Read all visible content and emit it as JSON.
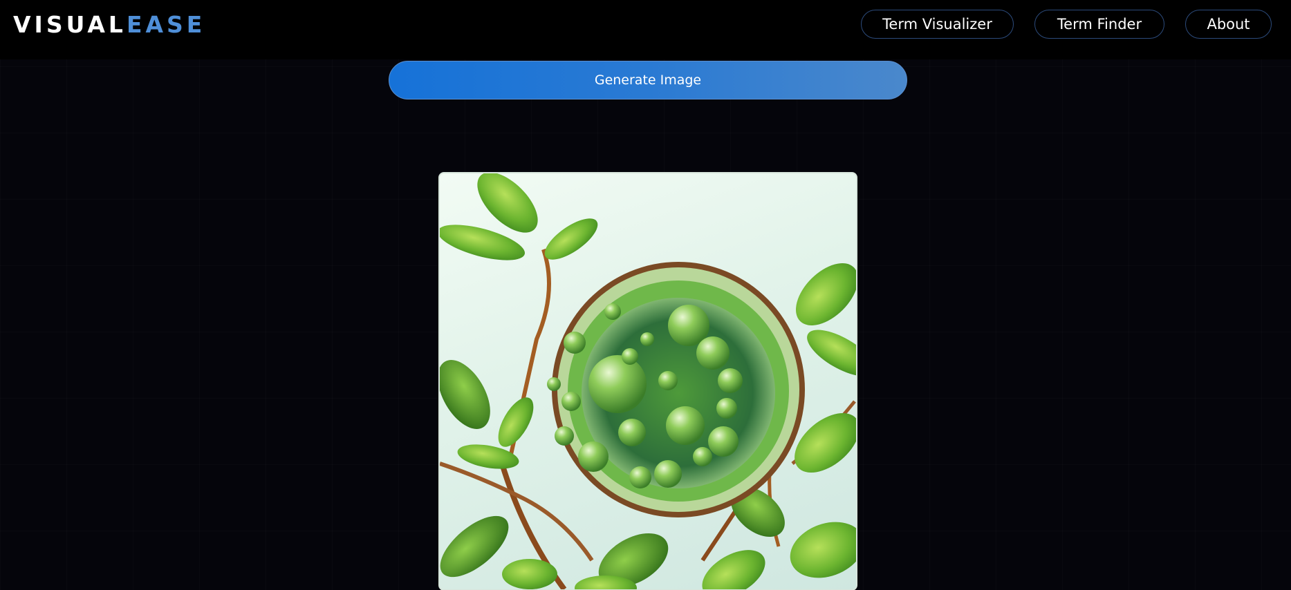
{
  "header": {
    "logo_part1": "VISUAL",
    "logo_part2": "EASE",
    "nav": [
      {
        "label": "Term Visualizer"
      },
      {
        "label": "Term Finder"
      },
      {
        "label": "About"
      }
    ]
  },
  "main": {
    "generate_label": "Generate Image",
    "image_alt_name": "generated-plant-cell-image"
  },
  "colors": {
    "accent": "#4f8fd8",
    "button_start": "#1672d8",
    "button_end": "#4a88cc",
    "background": "#05050b"
  }
}
